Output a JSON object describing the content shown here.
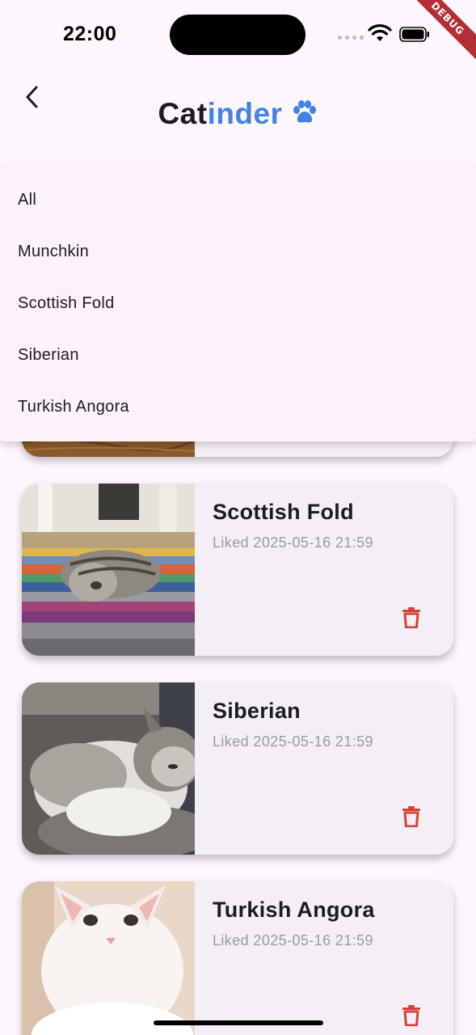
{
  "status_bar": {
    "time": "22:00",
    "debug_label": "DEBUG"
  },
  "app_bar": {
    "title_part1": "Cat",
    "title_part2": "inder",
    "back_icon": "chevron-left-icon",
    "paw_icon": "paw-icon"
  },
  "filter_dropdown": {
    "options": [
      "All",
      "Munchkin",
      "Scottish Fold",
      "Siberian",
      "Turkish Angora"
    ]
  },
  "liked_cats": [
    {
      "breed": "Scottish Fold",
      "liked": "Liked 2025-05-16 21:59"
    },
    {
      "breed": "Siberian",
      "liked": "Liked 2025-05-16 21:59"
    },
    {
      "breed": "Turkish Angora",
      "liked": "Liked 2025-05-16 21:59"
    }
  ],
  "colors": {
    "accent_blue": "#3f83e6",
    "delete_red": "#d84035",
    "background": "#fdf7fd",
    "card": "#f4eff6"
  }
}
